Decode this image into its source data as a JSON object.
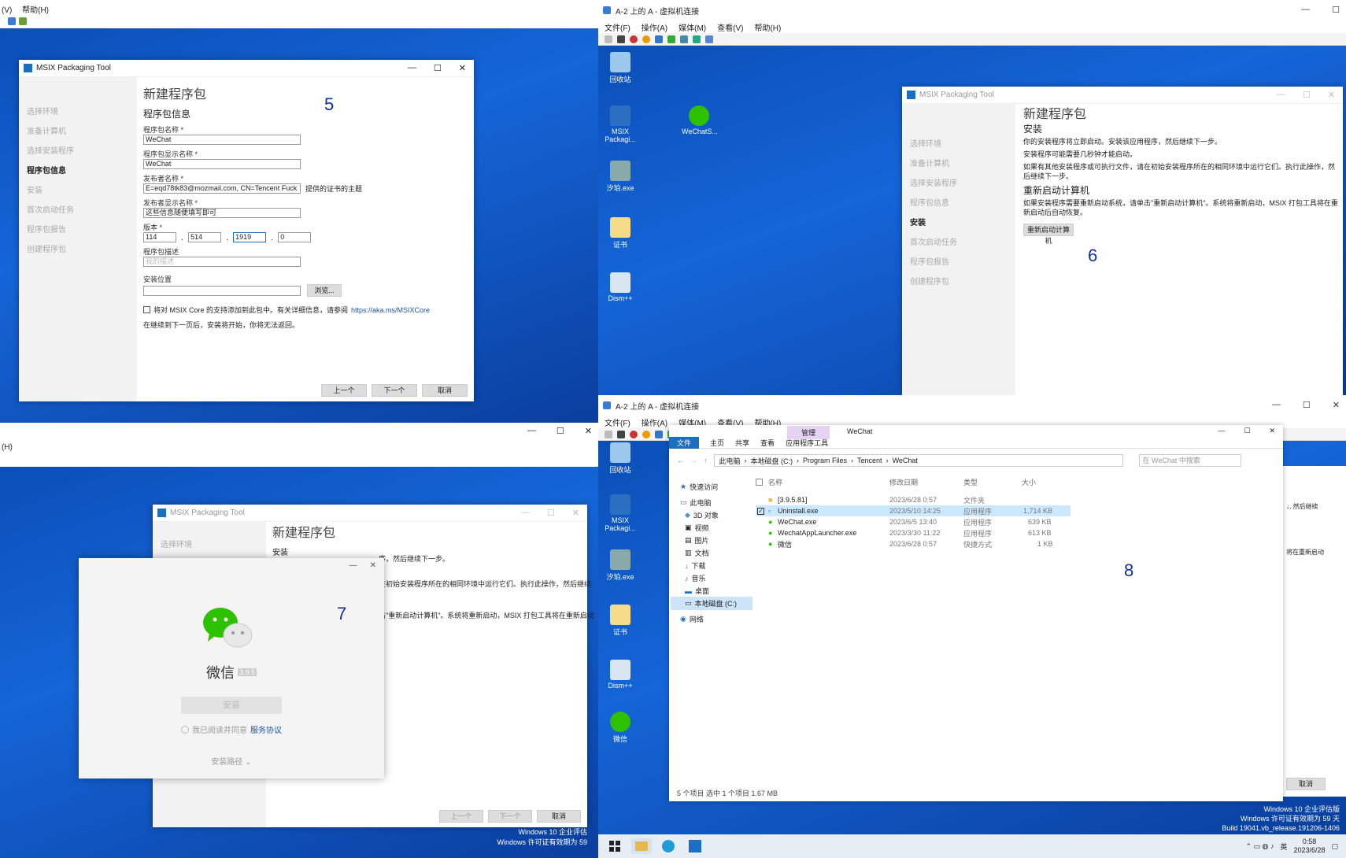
{
  "q5": {
    "host_menu": [
      "(V)",
      "帮助(H)"
    ],
    "window_title": "MSIX Packaging Tool",
    "steps": [
      "选择环境",
      "准备计算机",
      "选择安装程序",
      "程序包信息",
      "安装",
      "首次启动任务",
      "程序包报告",
      "创建程序包"
    ],
    "active_step": "程序包信息",
    "heading": "新建程序包",
    "section": "程序包信息",
    "pkg_name_label": "程序包名称 *",
    "pkg_name": "WeChat",
    "pkg_display_label": "程序包显示名称 *",
    "pkg_display": "WeChat",
    "publisher_label": "发布者名称 *",
    "publisher": "E=eqd78tk83@mozmail.com, CN=Tencent Fuck",
    "publisher_hint": "提供的证书的主题",
    "publisher_display_label": "发布者显示名称 *",
    "publisher_display": "这些信息随便填写即可",
    "version_label": "版本 *",
    "version": [
      "114",
      "514",
      "1919",
      "0"
    ],
    "desc_label": "程序包描述",
    "desc_placeholder": "我的描述",
    "install_loc_label": "安装位置",
    "browse": "浏览...",
    "msix_core_text": "将对 MSIX Core 的支持添加到此包中。有关详细信息，请参阅",
    "msix_core_link": "https://aka.ms/MSIXCore",
    "note": "在继续到下一页后，安装将开始，你将无法返回。",
    "prev": "上一个",
    "next": "下一个",
    "cancel": "取消",
    "number": "5"
  },
  "q6": {
    "title": "A-2 上的 A - 虚拟机连接",
    "menu": [
      "文件(F)",
      "操作(A)",
      "媒体(M)",
      "查看(V)",
      "帮助(H)"
    ],
    "desktop_icons": [
      "回收站",
      "MSIX Packagi...",
      "WeChatS...",
      "汐珀.exe",
      "证书",
      "Dism++"
    ],
    "window_title": "MSIX Packaging Tool",
    "steps": [
      "选择环境",
      "准备计算机",
      "选择安装程序",
      "程序包信息",
      "安装",
      "首次启动任务",
      "程序包报告",
      "创建程序包"
    ],
    "active_step": "安装",
    "heading": "新建程序包",
    "section": "安装",
    "p1": "你的安装程序将立即启动。安装该应用程序，然后继续下一步。",
    "p2": "安装程序可能需要几秒钟才能启动。",
    "p3": "如果有其他安装程序或可执行文件，请在初始安装程序所在的相同环境中运行它们。执行此操作，然后继续下一步。",
    "restart_heading": "重新启动计算机",
    "p4": "如果安装程序需要重新启动系统，请单击\"重新启动计算机\"。系统将重新启动，MSIX 打包工具将在重新启动后自动恢复。",
    "restart_btn": "重新启动计算机",
    "number": "6"
  },
  "q7": {
    "host_menu": "(H)",
    "window_title": "MSIX Packaging Tool",
    "first_step": "选择环境",
    "heading": "新建程序包",
    "section": "安装",
    "bg_p1": "序，然后继续下一步。",
    "bg_p3": "在初始安装程序所在的相同环境中运行它们。执行此操作，然后继续",
    "bg_p4": "击\"重新启动计算机\"。系统将重新启动，MSIX 打包工具将在重新启动",
    "app_name": "微信",
    "app_version": "3.9.5",
    "install_btn": "安装",
    "agree_text": "我已阅读并同意",
    "agree_link": "服务协议",
    "install_path": "安装路径 ⌄",
    "prev": "上一个",
    "next": "下一个",
    "cancel": "取消",
    "number": "7",
    "watermark": "Windows 10 企业评估",
    "watermark2": "Windows 许可证有效期为 59"
  },
  "q8": {
    "title": "A-2 上的 A - 虚拟机连接",
    "menu": [
      "文件(F)",
      "操作(A)",
      "媒体(M)",
      "查看(V)",
      "帮助(H)"
    ],
    "desktop_icons": [
      "回收站",
      "MSIX Packagi...",
      "汐珀.exe",
      "证书",
      "Dism++",
      "微信"
    ],
    "explorer": {
      "manage_tab": "管理",
      "title": "WeChat",
      "tabs": [
        "文件",
        "主页",
        "共享",
        "查看",
        "应用程序工具"
      ],
      "breadcrumb": [
        "此电脑",
        "本地磁盘 (C:)",
        "Program Files",
        "Tencent",
        "WeChat"
      ],
      "search_placeholder": "在 WeChat 中搜索",
      "columns": [
        "名称",
        "修改日期",
        "类型",
        "大小"
      ],
      "rows": [
        {
          "name": "[3.9.5.81]",
          "date": "2023/6/28 0:57",
          "type": "文件夹",
          "size": ""
        },
        {
          "name": "Uninstall.exe",
          "date": "2023/5/10 14:25",
          "type": "应用程序",
          "size": "1,714 KB"
        },
        {
          "name": "WeChat.exe",
          "date": "2023/6/5 13:40",
          "type": "应用程序",
          "size": "639 KB"
        },
        {
          "name": "WechatAppLauncher.exe",
          "date": "2023/3/30 11:22",
          "type": "应用程序",
          "size": "613 KB"
        },
        {
          "name": "微信",
          "date": "2023/6/28 0:57",
          "type": "快捷方式",
          "size": "1 KB"
        }
      ],
      "nav": [
        "快速访问",
        "此电脑",
        "3D 对象",
        "视频",
        "图片",
        "文档",
        "下载",
        "音乐",
        "桌面",
        "本地磁盘 (C:)",
        "网络"
      ],
      "status": "5 个项目    选中 1 个项目  1.67 MB"
    },
    "bg_text1": "↓, 然后继续",
    "bg_text2": "将在重新启动",
    "cancel": "取消",
    "number": "8",
    "watermark1": "Windows 10 企业评估版",
    "watermark2": "Windows 许可证有效期为 59 天",
    "watermark3": "Build 19041.vb_release.191206-1406",
    "clock_time": "0:58",
    "clock_date": "2023/6/28",
    "tray_ime": "英"
  },
  "colors": {
    "win_blue": "#1565d8",
    "accent": "#1b6ec2",
    "wechat_green": "#2dc100",
    "link": "#1a56b0"
  }
}
